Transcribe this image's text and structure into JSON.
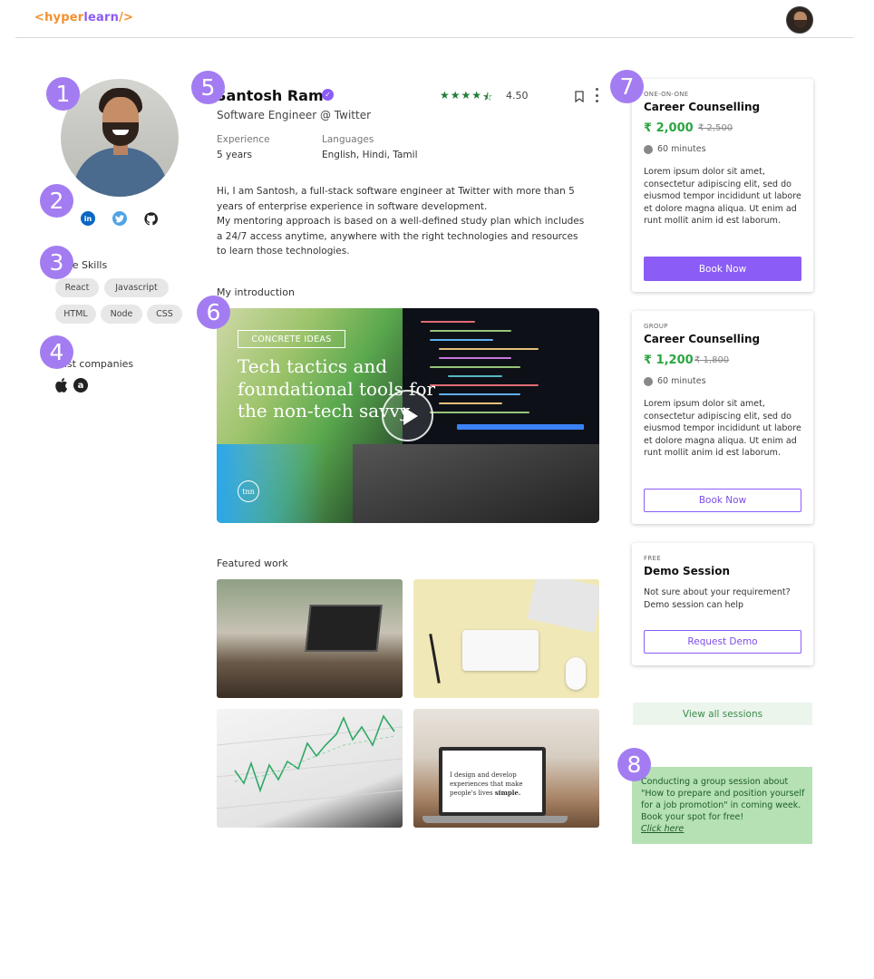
{
  "header": {
    "logo": {
      "open": "<",
      "hyper": "hyper",
      "learn": "learn",
      "close": "/>"
    },
    "accent_orange": "#f2902f",
    "accent_purple": "#8b5cf6"
  },
  "annotations": [
    "1",
    "2",
    "3",
    "4",
    "5",
    "6",
    "7",
    "8"
  ],
  "left": {
    "social_icons": [
      "linkedin-icon",
      "twitter-icon",
      "github-icon"
    ],
    "linkedin_glyph": "in",
    "skills_label": "Core Skills",
    "skills": [
      "React",
      "Javascript",
      "HTML",
      "Node",
      "CSS"
    ],
    "companies_label": "Past companies",
    "companies": [
      "apple-icon",
      "amazon-icon"
    ],
    "amazon_glyph": "a",
    "apple_glyph": ""
  },
  "profile": {
    "name": "Santosh Ram",
    "verified_glyph": "✓",
    "rating": "4.50",
    "stars": [
      "★",
      "★",
      "★",
      "★",
      "⯪"
    ],
    "subtitle": "Software Engineer @ Twitter",
    "experience_label": "Experience",
    "experience_value": "5 years",
    "languages_label": "Languages",
    "languages_value": "English, Hindi, Tamil",
    "bio_1": "Hi, I am Santosh, a full-stack software engineer at Twitter with more than 5 years of enterprise experience in software development.",
    "bio_2": "My mentoring approach is based on a well-defined study plan which includes a 24/7 access anytime, anywhere with the right technologies and resources to learn those technologies."
  },
  "intro": {
    "label": "My introduction",
    "tag": "CONCRETE IDEAS",
    "headline": "Tech tactics and foundational tools for the non-tech savvy",
    "logo": "tnn"
  },
  "featured": {
    "label": "Featured work",
    "thumb4_text_1": "I design and develop experiences that make people's lives ",
    "thumb4_text_bold": "simple."
  },
  "sessions": [
    {
      "kind": "ONE-ON-ONE",
      "title": "Career Counselling",
      "price": "₹ 2,000",
      "old_price": "₹ 2,500",
      "duration": "60 minutes",
      "desc": "Lorem ipsum dolor sit amet, consectetur adipiscing elit, sed do eiusmod tempor incididunt ut labore et dolore magna aliqua. Ut enim ad runt mollit anim id est laborum.",
      "cta": "Book Now"
    },
    {
      "kind": "GROUP",
      "title": "Career Counselling",
      "price": "₹ 1,200",
      "old_price": "₹ 1,800",
      "duration": "60 minutes",
      "desc": "Lorem ipsum dolor sit amet, consectetur adipiscing elit, sed do eiusmod tempor incididunt ut labore et dolore magna aliqua. Ut enim ad runt mollit anim id est laborum.",
      "cta": "Book Now"
    },
    {
      "kind": "FREE",
      "title": "Demo Session",
      "desc": "Not sure about your requirement? Demo session can help",
      "cta": "Request Demo"
    }
  ],
  "view_all": "View all sessions",
  "promo": {
    "text": "Conducting a group session about \"How to prepare and position yourself for a job promotion\" in coming week. Book your spot for free!",
    "link": "Click here"
  }
}
